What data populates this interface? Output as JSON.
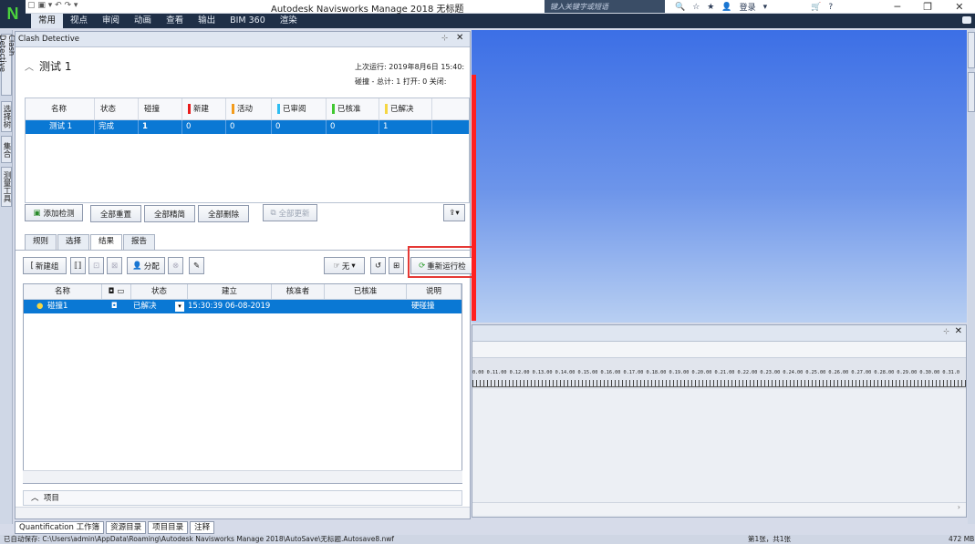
{
  "app": {
    "logo": "N",
    "title": "Autodesk Navisworks Manage 2018   无标题",
    "search_placeholder": "键入关键字或短语",
    "signin": "登录"
  },
  "ribbon": {
    "tabs": [
      "常用",
      "视点",
      "审阅",
      "动画",
      "查看",
      "输出",
      "BIM 360",
      "渲染"
    ],
    "active": "常用"
  },
  "left_tabs": [
    "Clash Detective",
    "选择树",
    "集合",
    "测量工具"
  ],
  "panel": {
    "title": "Clash Detective",
    "test_name": "测试 1",
    "last_run": "上次运行: 2019年8月6日 15:40:",
    "summary": "碰撞 - 总计: 1  打开: 0  关闭:",
    "tests_table": {
      "headers": [
        "名称",
        "状态",
        "碰撞",
        "新建",
        "活动",
        "已审阅",
        "已核准",
        "已解决"
      ],
      "header_colors": [
        "",
        "",
        "",
        "#e81c1c",
        "#f39c1d",
        "#2ebdf2",
        "#41c832",
        "#f5d642"
      ],
      "row": [
        "测试 1",
        "完成",
        "1",
        "0",
        "0",
        "0",
        "0",
        "1"
      ]
    },
    "buttons": {
      "add_test": "添加检测",
      "reset_all": "全部重置",
      "compact_all": "全部精简",
      "delete_all": "全部删除",
      "update_all": "全部更新"
    },
    "subtabs": [
      "规则",
      "选择",
      "结果",
      "报告"
    ],
    "active_subtab": "结果",
    "results_toolbar": {
      "new_group": "新建组",
      "assign": "分配",
      "status_none": "无",
      "rerun": "重新运行检"
    },
    "results_table": {
      "headers": [
        "名称",
        "",
        "状态",
        "建立",
        "核准者",
        "已核准",
        "说明"
      ],
      "row": {
        "name": "碰撞1",
        "status": "已解决",
        "created": "15:30:39 06-08-2019",
        "approved_by": "",
        "approved": "",
        "description": "硬碰撞"
      }
    },
    "items_label": "项目"
  },
  "timeliner": {
    "ticks": "0.00 0.11.00 0.12.00 0.13.00 0.14.00 0.15.00 0.16.00 0.17.00 0.18.00 0.19.00 0.20.00 0.21.00 0.22.00 0.23.00 0.24.00 0.25.00 0.26.00 0.27.00 0.28.00 0.29.00 0.30.00 0.31.0"
  },
  "bottom_tabs": [
    "Quantification 工作簿",
    "资源目录",
    "项目目录",
    "注释"
  ],
  "status": {
    "autosave": "已自动保存: C:\\Users\\admin\\AppData\\Roaming\\Autodesk Navisworks Manage 2018\\AutoSave\\无标题.Autosave8.nwf",
    "page": "第1张，共1张",
    "memory": "472 MB"
  }
}
